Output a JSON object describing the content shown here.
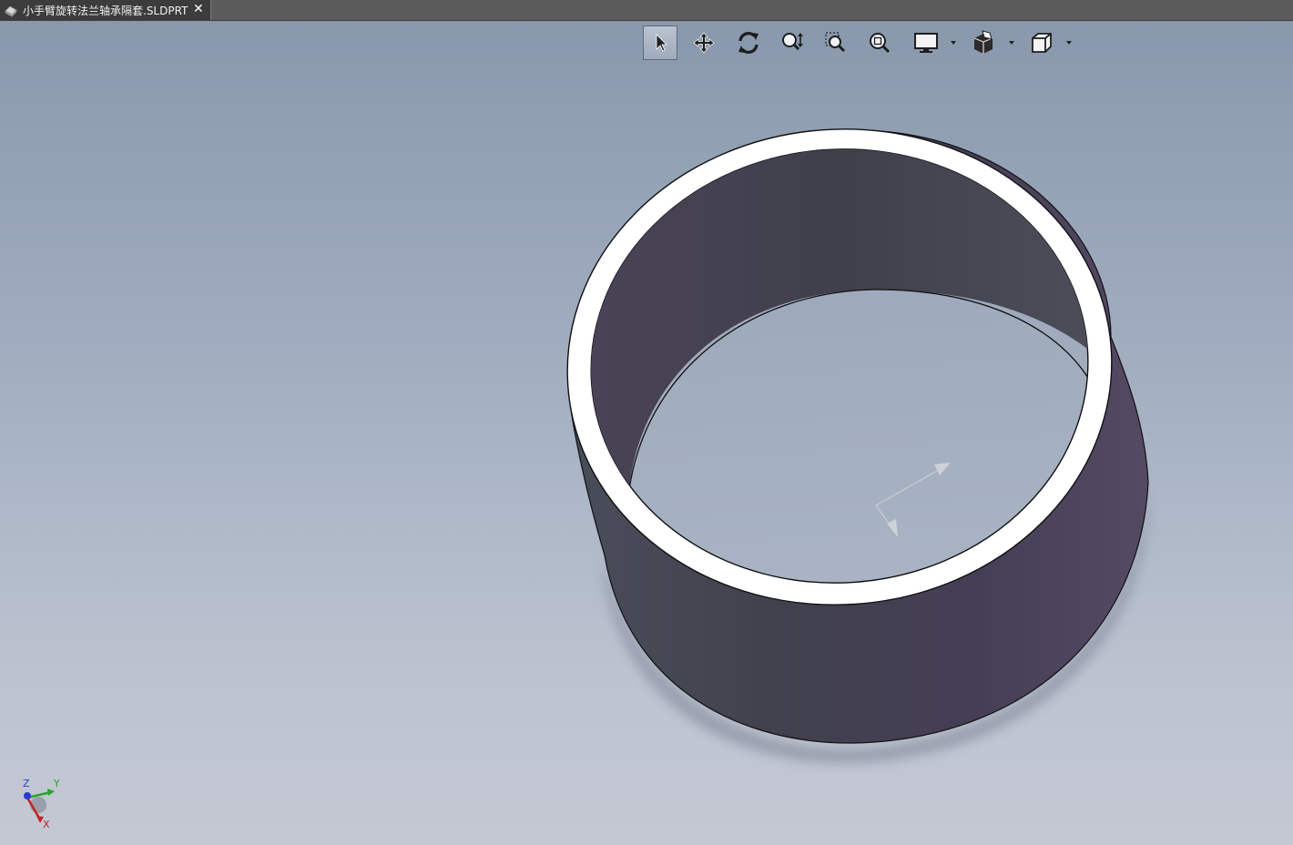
{
  "tab": {
    "title": "小手臂旋转法兰轴承隔套.SLDPRT",
    "close": "✕"
  },
  "toolbar": {
    "buttons": [
      {
        "name": "select-icon"
      },
      {
        "name": "pan-icon"
      },
      {
        "name": "rotate-icon"
      },
      {
        "name": "zoom-in-out-icon"
      },
      {
        "name": "zoom-to-area-icon"
      },
      {
        "name": "zoom-to-fit-icon"
      },
      {
        "name": "display-style-icon"
      },
      {
        "name": "hide-show-icon"
      },
      {
        "name": "view-orientation-icon"
      }
    ]
  },
  "triad": {
    "z": "Z",
    "y": "Y",
    "x": "X"
  },
  "colors": {
    "part_face": "#4b4558",
    "part_face_dark": "#40404c",
    "rim": "#ffffff",
    "background_top": "#8797ab",
    "background_bottom": "#c4c8d3"
  }
}
